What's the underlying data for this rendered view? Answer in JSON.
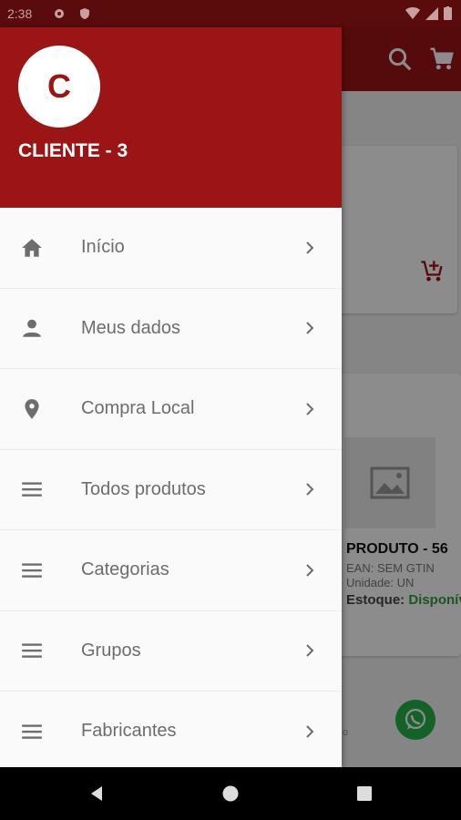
{
  "status_bar": {
    "time": "2:38"
  },
  "drawer": {
    "avatar_letter": "C",
    "client_name": "CLIENTE - 3",
    "items": [
      {
        "label": "Início",
        "icon": "home-icon"
      },
      {
        "label": "Meus dados",
        "icon": "person-icon"
      },
      {
        "label": "Compra Local",
        "icon": "location-pin-icon"
      },
      {
        "label": "Todos produtos",
        "icon": "menu-lines-icon"
      },
      {
        "label": "Categorias",
        "icon": "menu-lines-icon"
      },
      {
        "label": "Grupos",
        "icon": "menu-lines-icon"
      },
      {
        "label": "Fabricantes",
        "icon": "menu-lines-icon"
      }
    ]
  },
  "background": {
    "product_title": "PRODUTO - 56",
    "ean": "EAN: SEM GTIN",
    "unidade": "Unidade: UN",
    "estoque_label": "Estoque:",
    "estoque_value": "Disponível",
    "footer_fragment": "o"
  },
  "colors": {
    "primary": "#9c1515",
    "whatsapp": "#25b24a",
    "stock_ok": "#2e9e3a"
  }
}
